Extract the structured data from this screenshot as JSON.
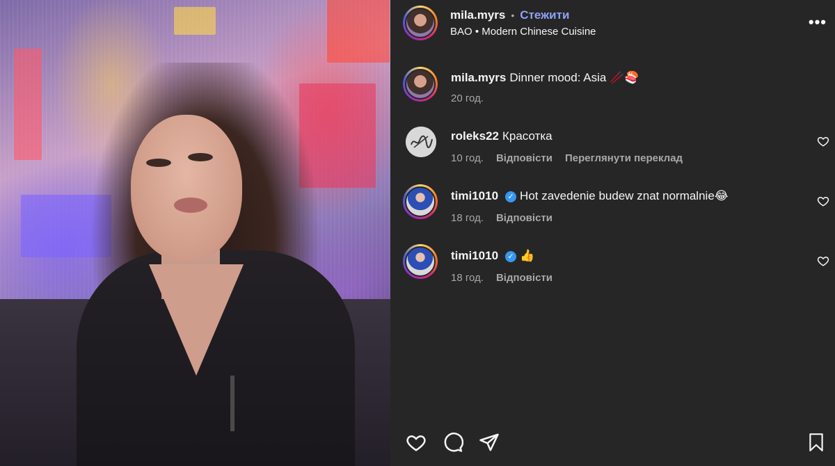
{
  "post": {
    "author": "mila.myrs",
    "follow_label": "Стежити",
    "location": "BAO • Modern Chinese Cuisine",
    "caption": "Dinner mood: Asia 🥢🍣",
    "caption_time": "20 год."
  },
  "comments": [
    {
      "user": "roleks22",
      "verified": false,
      "text": "Красотка",
      "time": "10 год.",
      "actions": [
        "Відповісти",
        "Переглянути переклад"
      ]
    },
    {
      "user": "timi1010",
      "verified": true,
      "text": "Hot zavedenie budew znat normalnie😂",
      "time": "18 год.",
      "actions": [
        "Відповісти"
      ]
    },
    {
      "user": "timi1010",
      "verified": true,
      "text": "👍",
      "time": "18 год.",
      "actions": [
        "Відповісти"
      ]
    }
  ],
  "icons": {
    "more": "more-options-icon",
    "like": "heart-icon",
    "comment": "comment-icon",
    "share": "send-icon",
    "save": "bookmark-icon",
    "verified": "verified-badge-icon",
    "comment_like": "heart-icon"
  },
  "colors": {
    "background": "#262626",
    "follow": "#8ea1f4",
    "secondary_text": "#a8a8a8",
    "verified": "#3897f0"
  }
}
